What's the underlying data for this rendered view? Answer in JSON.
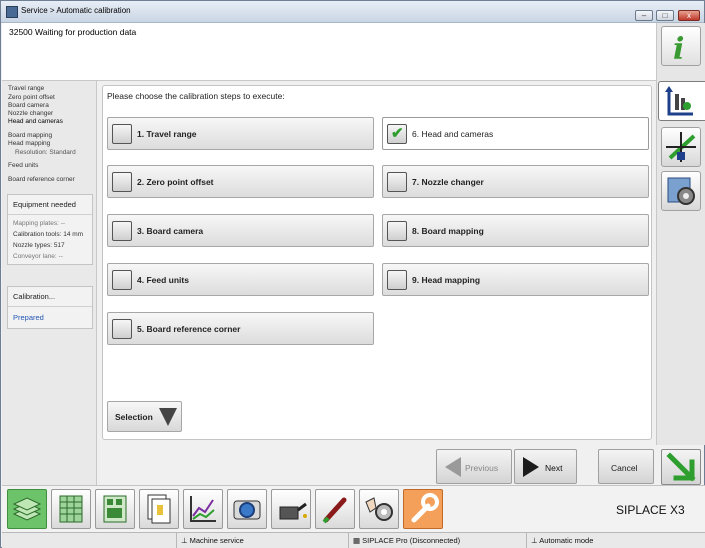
{
  "window": {
    "title": "Service > Automatic calibration",
    "minimize": "–",
    "maximize": "□",
    "close": "x"
  },
  "status_message": "32500 Waiting for production data",
  "left": {
    "steps": [
      "Travel range",
      "Zero point offset",
      "Board camera",
      "Nozzle changer",
      "Head and cameras",
      "Board mapping",
      "Head mapping",
      "Resolution: Standard",
      "Feed units",
      "Board reference corner"
    ],
    "equipment": {
      "title": "Equipment needed",
      "mapping_plates": "Mapping plates: --",
      "calibration_tools": "Calibration tools: 14 mm",
      "nozzle_types": "Nozzle types: 517",
      "conveyor_lane": "Conveyor lane: --"
    },
    "calibration": {
      "title": "Calibration...",
      "state": "Prepared"
    }
  },
  "content": {
    "prompt": "Please choose the calibration steps to execute:",
    "steps": [
      {
        "label": "1. Travel range",
        "checked": false
      },
      {
        "label": "2. Zero point offset",
        "checked": false
      },
      {
        "label": "3. Board camera",
        "checked": false
      },
      {
        "label": "4. Feed units",
        "checked": false
      },
      {
        "label": "5. Board reference corner",
        "checked": false
      },
      {
        "label": "6. Head and cameras",
        "checked": true
      },
      {
        "label": "7. Nozzle changer",
        "checked": false
      },
      {
        "label": "8. Board mapping",
        "checked": false
      },
      {
        "label": "9. Head mapping",
        "checked": false
      }
    ],
    "selection_label": "Selection"
  },
  "nav": {
    "previous": "Previous",
    "next": "Next",
    "cancel": "Cancel"
  },
  "brand": "SIPLACE X3",
  "statusbar": {
    "machine_service": "Machine service",
    "siplace_pro": "SIPLACE Pro (Disconnected)",
    "automatic_mode": "Automatic mode"
  },
  "colors": {
    "accent_green": "#6cc36a",
    "accent_orange": "#f4a05a",
    "link_blue": "#2457b5",
    "check_green": "#2e9e2e"
  }
}
